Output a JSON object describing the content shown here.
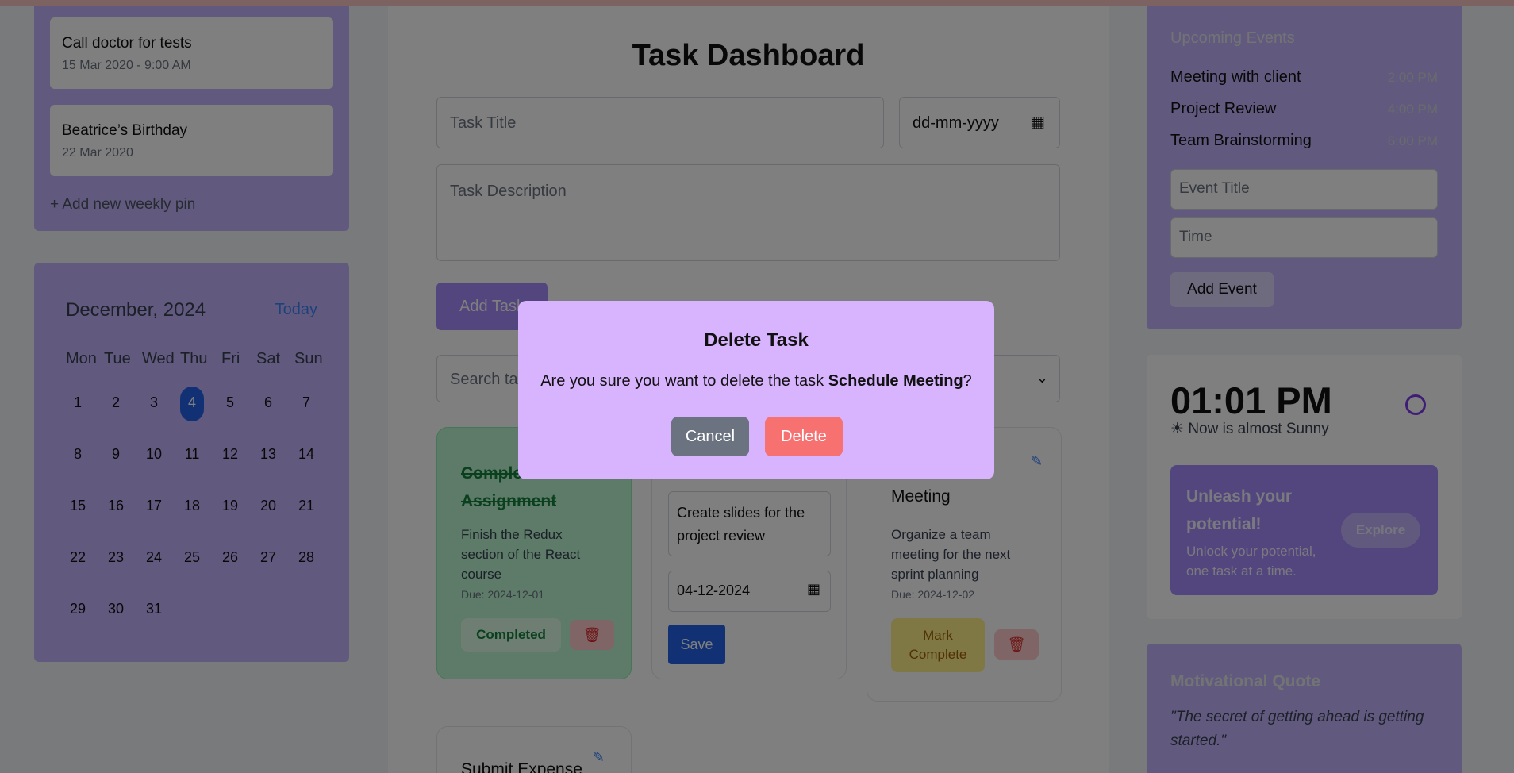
{
  "pins": [
    {
      "title": "Call doctor for tests",
      "date": "15 Mar 2020 - 9:00 AM"
    },
    {
      "title": "Beatrice’s Birthday",
      "date": "22 Mar 2020"
    }
  ],
  "pins_add": "+ Add new weekly pin",
  "calendar": {
    "month": "December, 2024",
    "today": "Today",
    "weekdays": [
      "Mon",
      "Tue",
      "Wed",
      "Thu",
      "Fri",
      "Sat",
      "Sun"
    ],
    "selected_day": "4"
  },
  "dashboard": {
    "title": "Task Dashboard",
    "task_title_placeholder": "Task Title",
    "date_placeholder": "dd-mm-yyyy",
    "description_placeholder": "Task Description",
    "add_task": "Add Task",
    "search_placeholder": "Search tasks..."
  },
  "tasks": {
    "card1": {
      "title": "Complete Assignment",
      "desc": "Finish the Redux section of the React course",
      "due": "Due: 2024-12-01",
      "status": "Completed"
    },
    "card2": {
      "desc_value": "Create slides for the project review",
      "date_value": "04-12-2024",
      "save": "Save"
    },
    "card3": {
      "title": "Meeting",
      "desc": "Organize a team meeting for the next sprint planning",
      "due": "Due: 2024-12-02",
      "action": "Mark Complete"
    },
    "card4": {
      "title": "Submit Expense"
    }
  },
  "events": {
    "heading": "Upcoming Events",
    "items": [
      {
        "name": "Meeting with client",
        "time": "2:00 PM"
      },
      {
        "name": "Project Review",
        "time": "4:00 PM"
      },
      {
        "name": "Team Brainstorming",
        "time": "6:00 PM"
      }
    ],
    "title_placeholder": "Event Title",
    "time_placeholder": "Time",
    "add_event": "Add Event"
  },
  "clock": {
    "time": "01:01 PM",
    "weather": "Now is almost Sunny"
  },
  "promo": {
    "title": "Unleash your potential!",
    "subtitle": "Unlock your potential, one task at a time.",
    "button": "Explore"
  },
  "quote": {
    "heading": "Motivational Quote",
    "text": "\"The secret of getting ahead is getting started.\""
  },
  "modal": {
    "title": "Delete Task",
    "message_prefix": "Are you sure you want to delete the task ",
    "task_name": "Schedule Meeting",
    "message_suffix": "?",
    "cancel": "Cancel",
    "delete": "Delete"
  }
}
